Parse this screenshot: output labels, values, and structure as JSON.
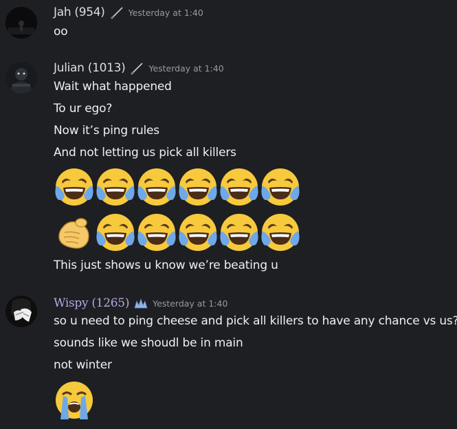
{
  "messages": [
    {
      "author": "Jah (954)",
      "timestamp": "Yesterday at 1:40",
      "lines": [
        "oo"
      ]
    },
    {
      "author": "Julian (1013)",
      "timestamp": "Yesterday at 1:40",
      "lines": [
        "Wait what happened",
        "To ur ego?",
        "Now it’s ping rules",
        "And not letting us pick all killers"
      ],
      "emoji_rows": [
        [
          "joy",
          "joy",
          "joy",
          "joy",
          "joy",
          "joy"
        ],
        [
          "point-at-viewer",
          "joy",
          "joy",
          "joy",
          "joy",
          "joy"
        ]
      ],
      "after_lines": [
        "This just shows u know we’re beating u"
      ]
    },
    {
      "author": "Wispy (1265)",
      "timestamp": "Yesterday at 1:40",
      "lines": [
        "so u need to ping cheese and pick all killers to have any chance vs us?",
        "sounds like we shoudl be in main",
        "not winter"
      ],
      "emoji_rows": [
        [
          "loudly-crying"
        ]
      ]
    }
  ],
  "colors": {
    "background": "#1e1f22",
    "text": "#eef0f2",
    "username": "#dbdee1",
    "wispy_username": "#b7a7e0",
    "timestamp": "#949ba4"
  }
}
